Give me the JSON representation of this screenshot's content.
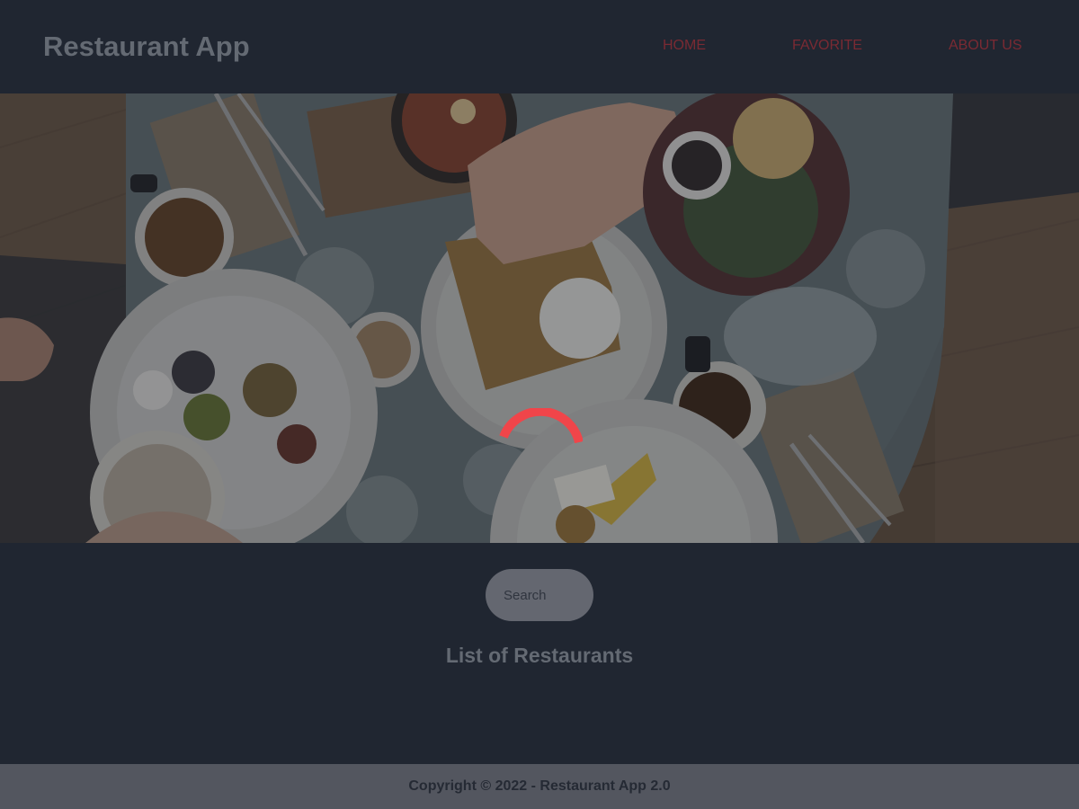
{
  "header": {
    "brand": "Restaurant App",
    "nav": [
      {
        "label": "HOME"
      },
      {
        "label": "FAVORITE"
      },
      {
        "label": "ABOUT US"
      }
    ]
  },
  "hero": {
    "image": "restaurant-table-breakfast-photo"
  },
  "search": {
    "placeholder": "Search",
    "value": ""
  },
  "main": {
    "title": "List of Restaurants"
  },
  "loading": {
    "icon": "loading-spinner-icon",
    "color": "#f0454a"
  },
  "footer": {
    "text": "Copyright © 2022 - Restaurant App 2.0"
  },
  "colors": {
    "background": "#202631",
    "nav_link": "#7a2a33",
    "brand_text": "#646a73",
    "footer_bg": "#53565f"
  }
}
